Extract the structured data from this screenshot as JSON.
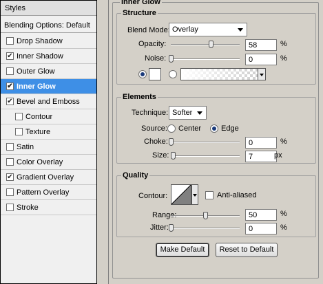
{
  "styles_panel": {
    "title": "Styles",
    "blending_options": "Blending Options: Default",
    "items": [
      {
        "label": "Drop Shadow",
        "checked": false,
        "selected": false,
        "indent": false
      },
      {
        "label": "Inner Shadow",
        "checked": true,
        "selected": false,
        "indent": false
      },
      {
        "label": "Outer Glow",
        "checked": false,
        "selected": false,
        "indent": false
      },
      {
        "label": "Inner Glow",
        "checked": true,
        "selected": true,
        "indent": false
      },
      {
        "label": "Bevel and Emboss",
        "checked": true,
        "selected": false,
        "indent": false
      },
      {
        "label": "Contour",
        "checked": false,
        "selected": false,
        "indent": true
      },
      {
        "label": "Texture",
        "checked": false,
        "selected": false,
        "indent": true
      },
      {
        "label": "Satin",
        "checked": false,
        "selected": false,
        "indent": false
      },
      {
        "label": "Color Overlay",
        "checked": false,
        "selected": false,
        "indent": false
      },
      {
        "label": "Gradient Overlay",
        "checked": true,
        "selected": false,
        "indent": false
      },
      {
        "label": "Pattern Overlay",
        "checked": false,
        "selected": false,
        "indent": false
      },
      {
        "label": "Stroke",
        "checked": false,
        "selected": false,
        "indent": false
      }
    ]
  },
  "inner_glow": {
    "title": "Inner Glow",
    "structure": {
      "title": "Structure",
      "blend_mode_label": "Blend Mode:",
      "blend_mode_value": "Overlay",
      "opacity_label": "Opacity:",
      "opacity_value": "58",
      "opacity_unit": "%",
      "opacity_level": 0.58,
      "noise_label": "Noise:",
      "noise_value": "0",
      "noise_unit": "%",
      "noise_level": 0
    },
    "elements": {
      "title": "Elements",
      "technique_label": "Technique:",
      "technique_value": "Softer",
      "source_label": "Source:",
      "source_center": "Center",
      "source_edge": "Edge",
      "choke_label": "Choke:",
      "choke_value": "0",
      "choke_unit": "%",
      "choke_level": 0,
      "size_label": "Size:",
      "size_value": "7",
      "size_unit": "px",
      "size_level": 0.03
    },
    "quality": {
      "title": "Quality",
      "contour_label": "Contour:",
      "anti_aliased_label": "Anti-aliased",
      "range_label": "Range:",
      "range_value": "50",
      "range_unit": "%",
      "range_level": 0.5,
      "jitter_label": "Jitter:",
      "jitter_value": "0",
      "jitter_unit": "%",
      "jitter_level": 0
    },
    "buttons": {
      "make_default": "Make Default",
      "reset_to_default": "Reset to Default"
    }
  },
  "colors": {
    "selected_bg": "#3e8fe6",
    "panel_bg": "#d4d0c8"
  }
}
